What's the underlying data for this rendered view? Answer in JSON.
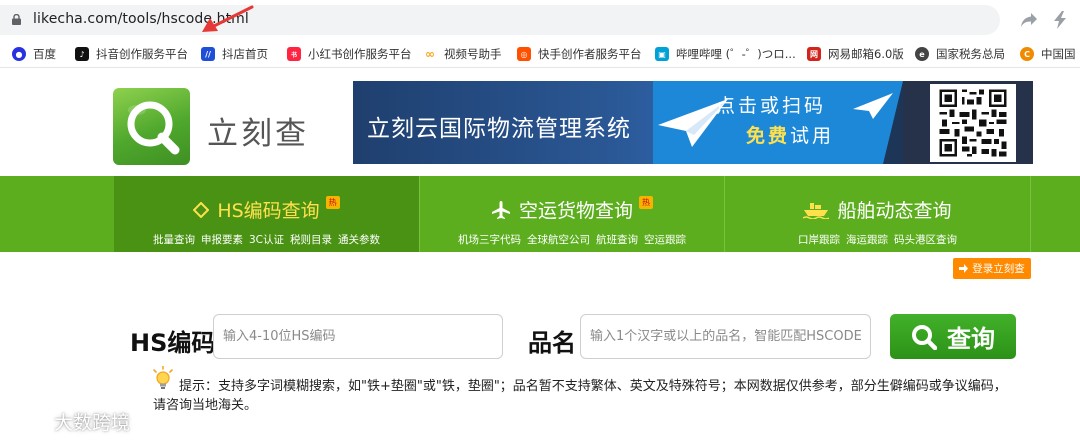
{
  "browser": {
    "url": "likecha.com/tools/hscode.html"
  },
  "bookmarks": [
    {
      "label": "百度",
      "icon": "baidu-paw-icon",
      "color": "#2932e1"
    },
    {
      "label": "抖音创作服务平台",
      "icon": "douyin-icon",
      "color": "#111111"
    },
    {
      "label": "抖店首页",
      "icon": "doudian-icon",
      "color": "#1f4fd8"
    },
    {
      "label": "小红书创作服务平台",
      "icon": "xiaohongshu-icon",
      "color": "#ff2442"
    },
    {
      "label": "视频号助手",
      "icon": "shipinhao-icon",
      "color": "#f5a623"
    },
    {
      "label": "快手创作者服务平台",
      "icon": "kuaishou-icon",
      "color": "#ff5000"
    },
    {
      "label": "哔哩哔哩 (゜-゜)つロ...",
      "icon": "bilibili-icon",
      "color": "#00a1d6"
    },
    {
      "label": "网易邮箱6.0版",
      "icon": "netease-mail-icon",
      "color": "#d1241c"
    },
    {
      "label": "国家税务总局",
      "icon": "tax-bureau-icon",
      "color": "#444444"
    },
    {
      "label": "中国国",
      "icon": "china-site-icon",
      "color": "#f08a00"
    }
  ],
  "site": {
    "logo_text": "立刻查",
    "banner": {
      "title": "立刻云国际物流管理系统",
      "cta_line1": "点击或扫码",
      "cta_free": "免费",
      "cta_rest": "试用"
    }
  },
  "nav": [
    {
      "title": "HS编码查询",
      "hot": true,
      "subs": [
        "批量查询",
        "申报要素",
        "3C认证",
        "税则目录",
        "通关参数"
      ]
    },
    {
      "title": "空运货物查询",
      "hot": true,
      "subs": [
        "机场三字代码",
        "全球航空公司",
        "航班查询",
        "空运跟踪"
      ]
    },
    {
      "title": "船舶动态查询",
      "hot": false,
      "subs": [
        "口岸跟踪",
        "海运跟踪",
        "码头港区查询"
      ]
    }
  ],
  "hot_badge": "热",
  "login_label": "登录立刻查",
  "search": {
    "hs_label": "HS编码",
    "hs_placeholder": "输入4-10位HS编码",
    "name_label": "品名",
    "name_placeholder": "输入1个汉字或以上的品名，智能匹配HSCODE",
    "button": "查询"
  },
  "tip": "提示：支持多字词模糊搜索，如\"铁+垫圈\"或\"铁，垫圈\"；品名暂不支持繁体、英文及特殊符号；本网数据仅供参考，部分生僻编码或争议编码，请咨询当地海关。",
  "watermark": "大数跨境",
  "colors": {
    "nav_green": "#5cae1f",
    "nav_active": "#4a9213",
    "button_green": "#2c9217",
    "login_orange": "#ff8a00",
    "annotation_red": "#e53935"
  }
}
